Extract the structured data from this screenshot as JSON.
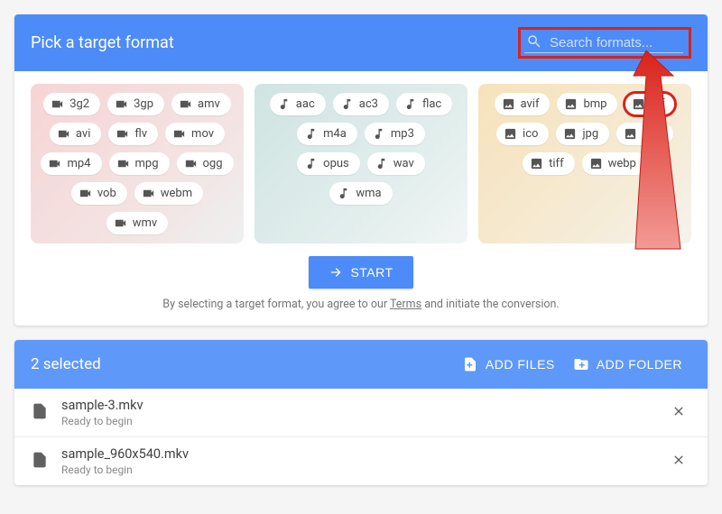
{
  "header": {
    "title": "Pick a target format"
  },
  "search": {
    "placeholder": "Search formats..."
  },
  "formats": {
    "video": [
      "3g2",
      "3gp",
      "amv",
      "avi",
      "flv",
      "mov",
      "mp4",
      "mpg",
      "ogg",
      "vob",
      "webm",
      "wmv"
    ],
    "audio": [
      "aac",
      "ac3",
      "flac",
      "m4a",
      "mp3",
      "opus",
      "wav",
      "wma"
    ],
    "image": [
      "avif",
      "bmp",
      "gif",
      "ico",
      "jpg",
      "png",
      "tiff",
      "webp"
    ]
  },
  "highlight_format": "gif",
  "actions": {
    "start": "START",
    "add_files": "ADD FILES",
    "add_folder": "ADD FOLDER"
  },
  "disclaimer": {
    "pre": "By selecting a target format, you agree to our ",
    "link": "Terms",
    "post": " and initiate the conversion."
  },
  "selected_count_label": "2 selected",
  "files": [
    {
      "name": "sample-3.mkv",
      "status": "Ready to begin"
    },
    {
      "name": "sample_960x540.mkv",
      "status": "Ready to begin"
    }
  ],
  "icons": {
    "video": "video-icon",
    "audio": "music-icon",
    "image": "image-icon"
  }
}
